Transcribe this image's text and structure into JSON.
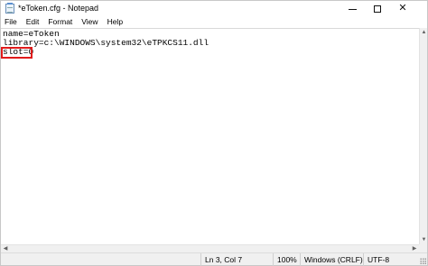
{
  "window": {
    "title": "*eToken.cfg - Notepad",
    "controls": {
      "minimize": "minimize-icon",
      "maximize": "maximize-icon",
      "close": "✕"
    }
  },
  "menubar": {
    "items": [
      {
        "label": "File"
      },
      {
        "label": "Edit"
      },
      {
        "label": "Format"
      },
      {
        "label": "View"
      },
      {
        "label": "Help"
      }
    ]
  },
  "editor": {
    "lines": [
      "name=eToken",
      "library=c:\\WINDOWS\\system32\\eTPKCS11.dll",
      "slot=0"
    ],
    "highlight_color": "#e01b1b"
  },
  "statusbar": {
    "position": "Ln 3, Col 7",
    "zoom": "100%",
    "line_ending": "Windows (CRLF)",
    "encoding": "UTF-8"
  }
}
